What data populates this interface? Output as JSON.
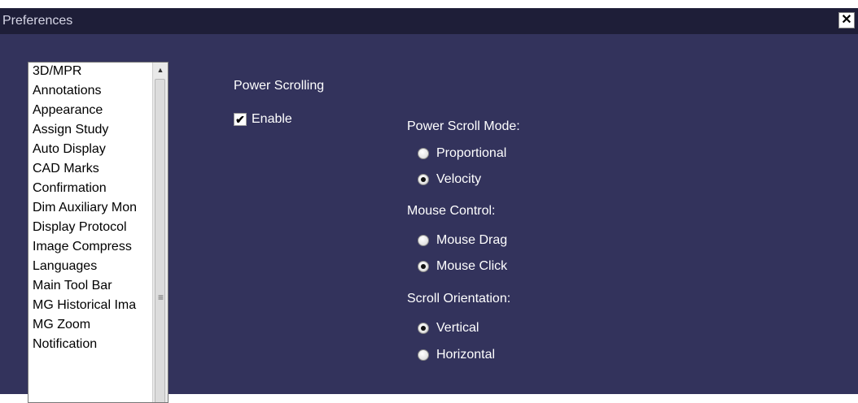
{
  "window": {
    "title": "Preferences",
    "close_label": "✕"
  },
  "sidebar": {
    "items": [
      "3D/MPR",
      "Annotations",
      "Appearance",
      "Assign Study",
      "Auto Display",
      "CAD Marks",
      "Confirmation",
      "Dim Auxiliary Mon",
      "Display Protocol",
      "Image Compress",
      "Languages",
      "Main Tool Bar",
      "MG Historical Ima",
      "MG Zoom",
      "Notification"
    ],
    "scroll_up_glyph": "▲",
    "grip_glyph": "≡"
  },
  "power_scrolling": {
    "section_title": "Power Scrolling",
    "enable_label": "Enable",
    "enable_checked": true,
    "check_glyph": "✔",
    "scroll_mode": {
      "label": "Power Scroll Mode:",
      "options": [
        "Proportional",
        "Velocity"
      ],
      "selected": "Velocity"
    },
    "mouse_control": {
      "label": "Mouse Control:",
      "options": [
        "Mouse Drag",
        "Mouse Click"
      ],
      "selected": "Mouse Click"
    },
    "scroll_orientation": {
      "label": "Scroll Orientation:",
      "options": [
        "Vertical",
        "Horizontal"
      ],
      "selected": "Vertical"
    }
  },
  "colors": {
    "background": "#33335c",
    "titlebar": "#1e1e38",
    "text": "#ffffff"
  }
}
